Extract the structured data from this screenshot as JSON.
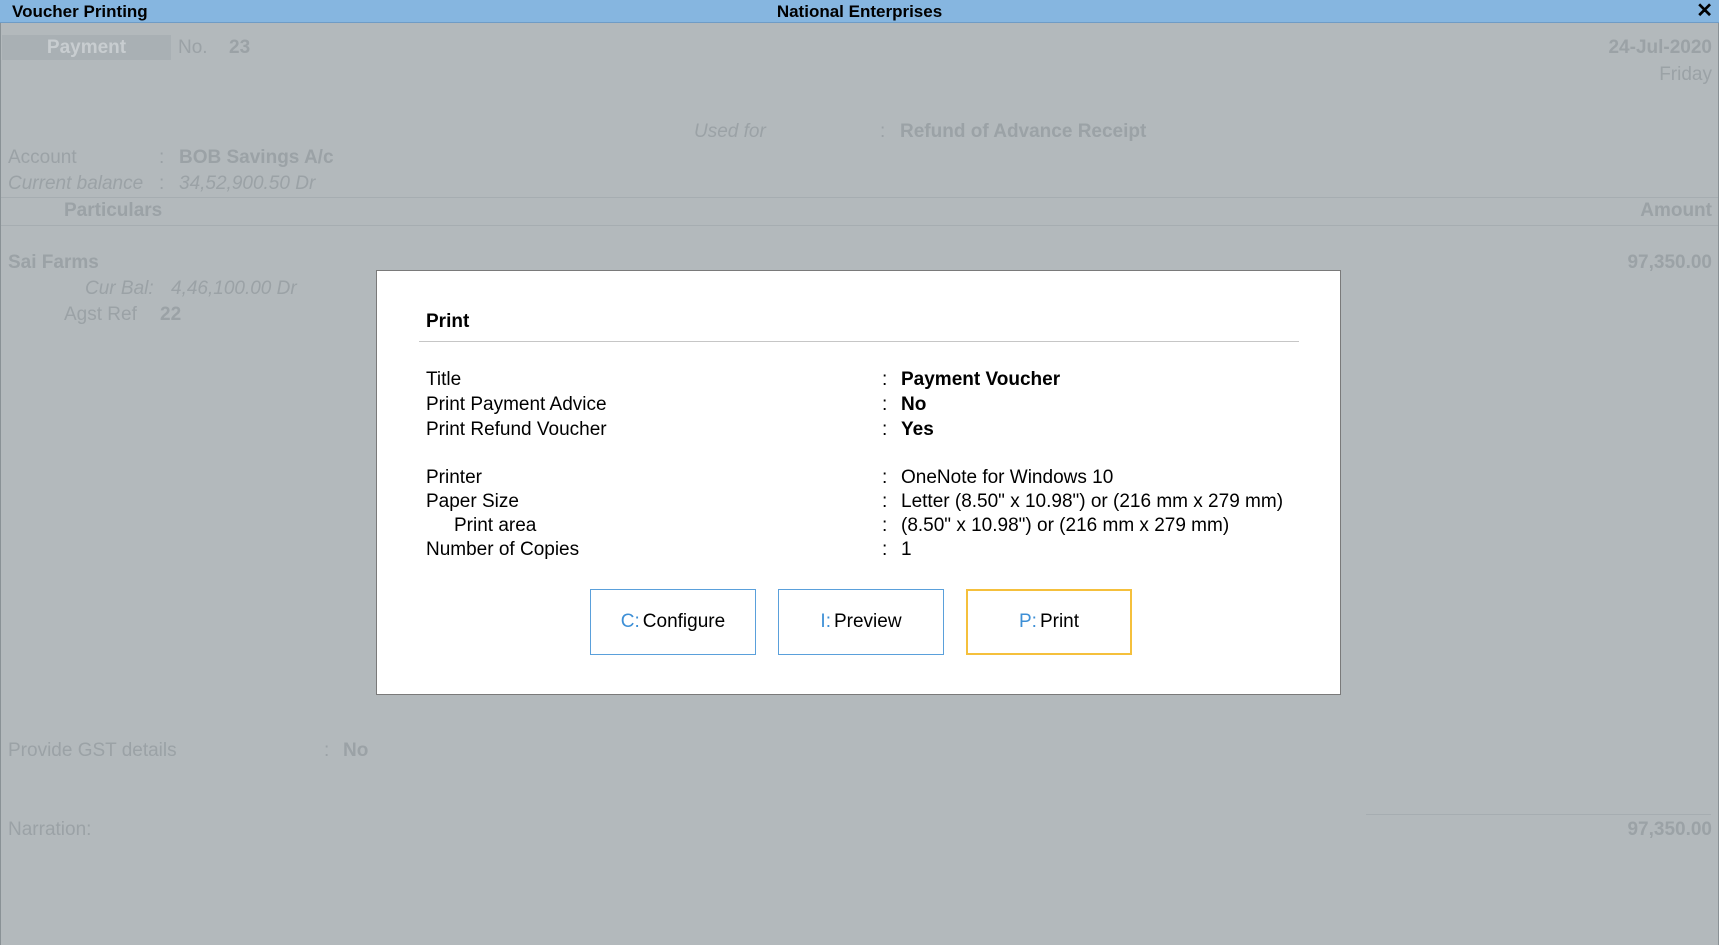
{
  "window": {
    "app_title": "Voucher Printing",
    "company": "National Enterprises",
    "close_glyph": "✕"
  },
  "voucher": {
    "type": "Payment",
    "no_label": "No.",
    "no_value": "23",
    "date": "24-Jul-2020",
    "day": "Friday",
    "used_for_label": "Used for",
    "used_for_colon": ":",
    "used_for_value": "Refund of Advance Receipt",
    "account_label": "Account",
    "account_colon": ":",
    "account_value": "BOB Savings A/c",
    "current_balance_label": "Current balance",
    "current_balance_colon": ":",
    "current_balance_value": "34,52,900.50 Dr",
    "particulars_header": "Particulars",
    "amount_header": "Amount",
    "entry_party": "Sai Farms",
    "entry_amount": "97,350.00",
    "cur_bal_label": "Cur Bal:",
    "cur_bal_value": "4,46,100.00 Dr",
    "agst_ref_label": "Agst Ref",
    "agst_ref_value": "22",
    "gst_label": "Provide GST details",
    "gst_colon": ":",
    "gst_value": "No",
    "narration_label": "Narration:",
    "total_amount": "97,350.00"
  },
  "dialog": {
    "title": "Print",
    "rows": [
      {
        "label": "Title",
        "colon": ":",
        "value": "Payment Voucher"
      },
      {
        "label": "Print Payment Advice",
        "colon": ":",
        "value": "No"
      },
      {
        "label": "Print Refund Voucher",
        "colon": ":",
        "value": "Yes"
      },
      {
        "label": "Printer",
        "colon": ":",
        "value": "OneNote for Windows 10"
      },
      {
        "label": "Paper Size",
        "colon": ":",
        "value": "Letter (8.50\" x 10.98\") or (216 mm x 279 mm)"
      },
      {
        "label": "Print area",
        "colon": ":",
        "value": "(8.50\" x 10.98\") or (216 mm x 279 mm)"
      },
      {
        "label": "Number of Copies",
        "colon": ":",
        "value": "1"
      }
    ],
    "buttons": [
      {
        "key": "C:",
        "label": "Configure"
      },
      {
        "key": "I:",
        "label": "Preview"
      },
      {
        "key": "P:",
        "label": "Print"
      }
    ]
  },
  "colors": {
    "titlebar": "#86b6e0",
    "background_dimmed": "#b3b9bc",
    "button_border": "#5aa0db",
    "button_focus_border": "#f5c03c",
    "hotkey": "#3d8fd6"
  }
}
